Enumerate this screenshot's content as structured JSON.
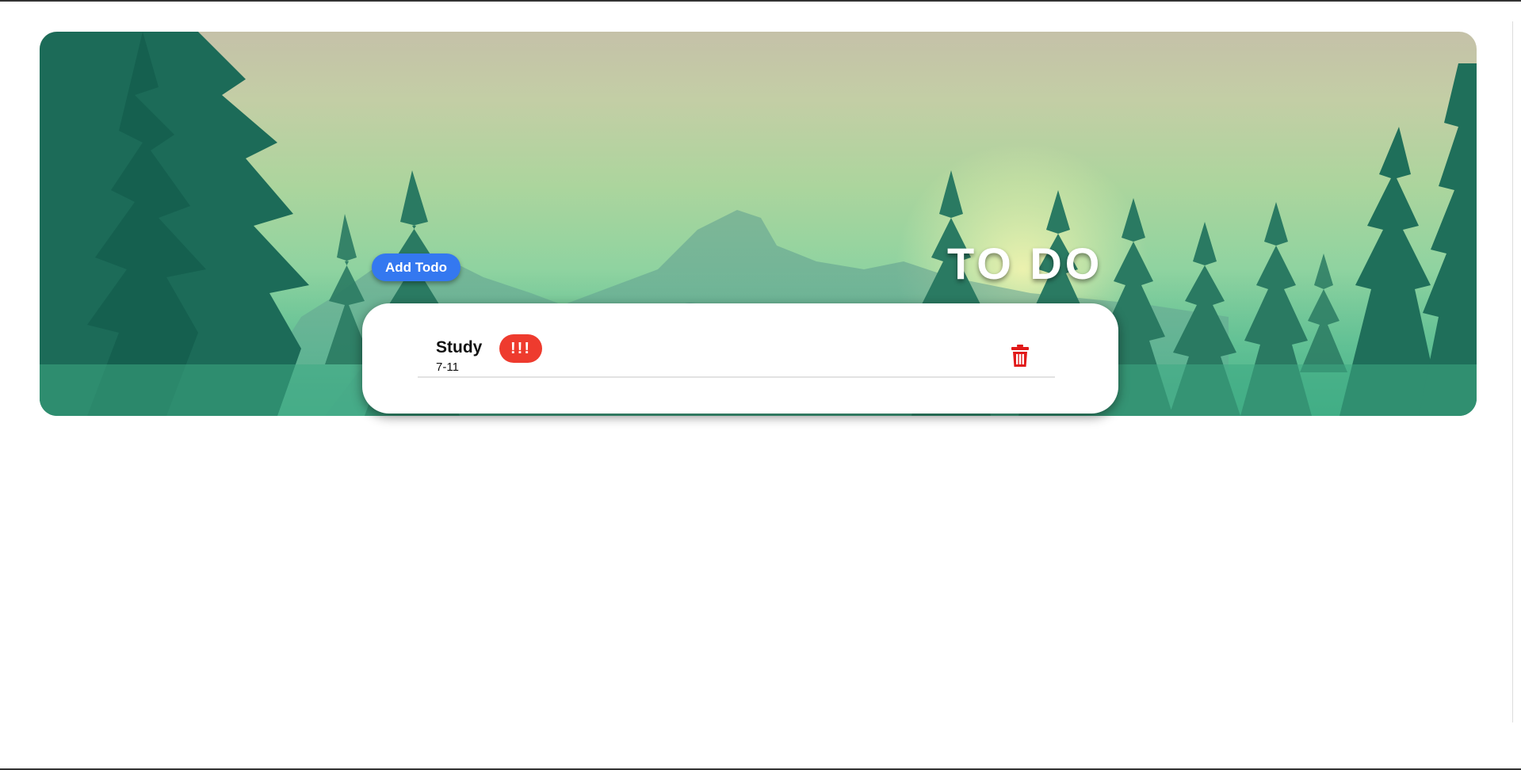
{
  "app": {
    "title": "TO DO",
    "add_button_label": "Add Todo"
  },
  "todos": [
    {
      "name": "Study",
      "date": "7-11",
      "priority": "!!!",
      "delete_icon": "trash-icon"
    }
  ],
  "colors": {
    "add_button": "#3478f0",
    "priority_badge": "#ee3b2e",
    "delete_icon": "#e11a1a",
    "title_text": "#ffffff"
  }
}
